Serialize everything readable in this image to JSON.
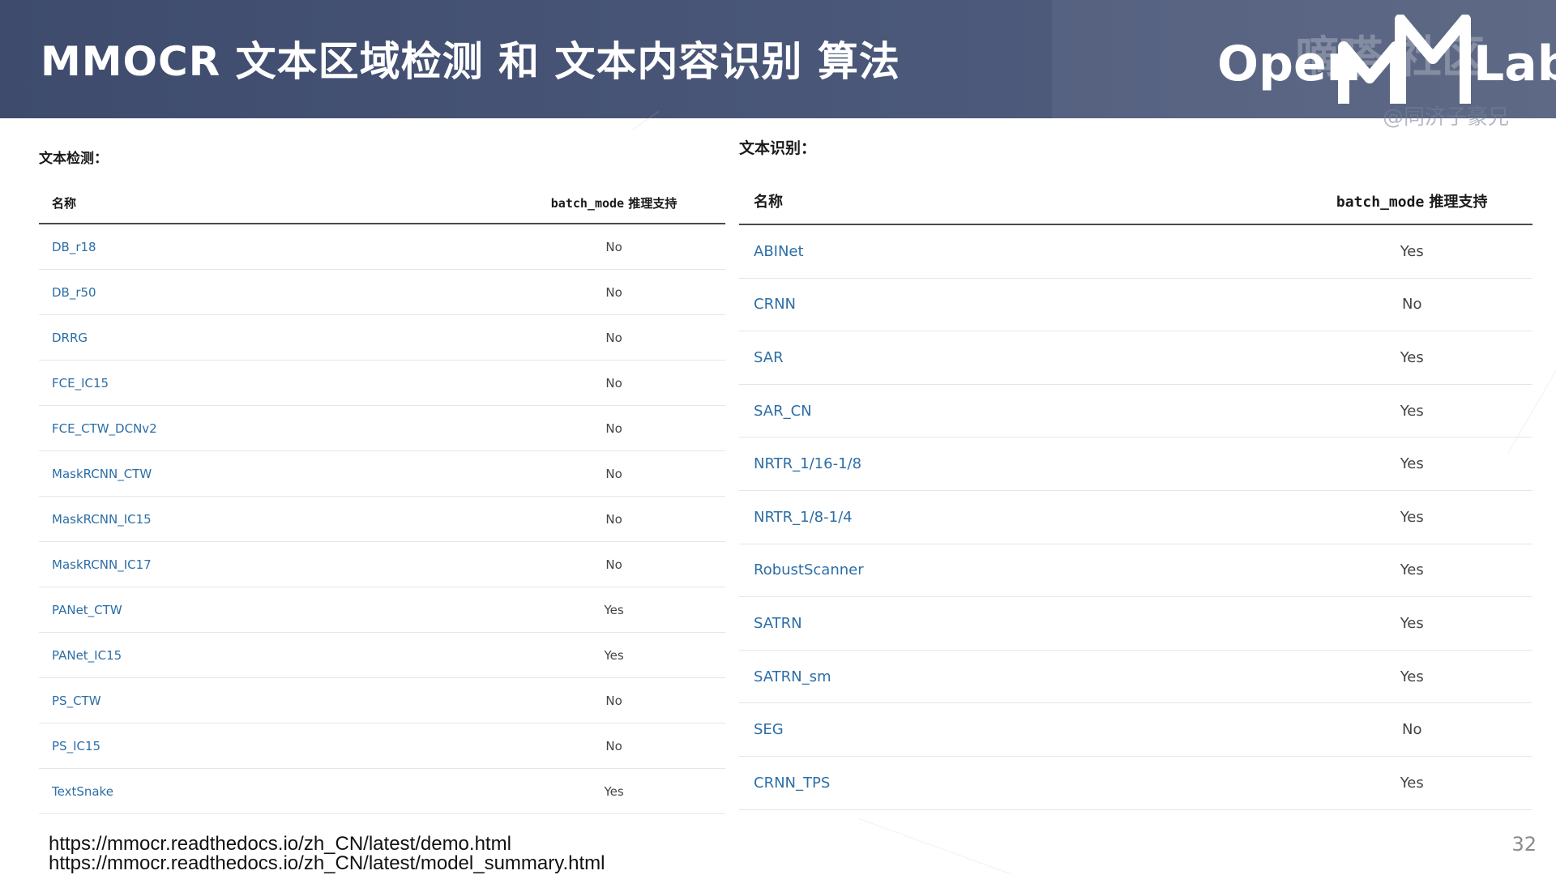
{
  "header": {
    "title": "MMOCR 文本区域检测 和 文本内容识别 算法",
    "logo_left": "Open",
    "logo_right": "Lab",
    "watermark": "嘀嗒 社区",
    "watermark_handle": "@同济子豪兄"
  },
  "detection": {
    "section_label": "文本检测：",
    "col_name": "名称",
    "col_batch_code": "batch_mode",
    "col_batch_text": " 推理支持",
    "rows": [
      {
        "name": "DB_r18",
        "batch": "No"
      },
      {
        "name": "DB_r50",
        "batch": "No"
      },
      {
        "name": "DRRG",
        "batch": "No"
      },
      {
        "name": "FCE_IC15",
        "batch": "No"
      },
      {
        "name": "FCE_CTW_DCNv2",
        "batch": "No"
      },
      {
        "name": "MaskRCNN_CTW",
        "batch": "No"
      },
      {
        "name": "MaskRCNN_IC15",
        "batch": "No"
      },
      {
        "name": "MaskRCNN_IC17",
        "batch": "No"
      },
      {
        "name": "PANet_CTW",
        "batch": "Yes"
      },
      {
        "name": "PANet_IC15",
        "batch": "Yes"
      },
      {
        "name": "PS_CTW",
        "batch": "No"
      },
      {
        "name": "PS_IC15",
        "batch": "No"
      },
      {
        "name": "TextSnake",
        "batch": "Yes"
      }
    ]
  },
  "recognition": {
    "section_label": "文本识别：",
    "col_name": "名称",
    "col_batch_code": "batch_mode",
    "col_batch_text": " 推理支持",
    "rows": [
      {
        "name": "ABINet",
        "batch": "Yes"
      },
      {
        "name": "CRNN",
        "batch": "No"
      },
      {
        "name": "SAR",
        "batch": "Yes"
      },
      {
        "name": "SAR_CN",
        "batch": "Yes"
      },
      {
        "name": "NRTR_1/16-1/8",
        "batch": "Yes"
      },
      {
        "name": "NRTR_1/8-1/4",
        "batch": "Yes"
      },
      {
        "name": "RobustScanner",
        "batch": "Yes"
      },
      {
        "name": "SATRN",
        "batch": "Yes"
      },
      {
        "name": "SATRN_sm",
        "batch": "Yes"
      },
      {
        "name": "SEG",
        "batch": "No"
      },
      {
        "name": "CRNN_TPS",
        "batch": "Yes"
      }
    ]
  },
  "footer": {
    "link_demo": "https://mmocr.readthedocs.io/zh_CN/latest/demo.html",
    "link_models": "https://mmocr.readthedocs.io/zh_CN/latest/model_summary.html",
    "page_number": "32"
  },
  "colors": {
    "header_bg": "#4a5779",
    "link": "#2c6ea6"
  }
}
